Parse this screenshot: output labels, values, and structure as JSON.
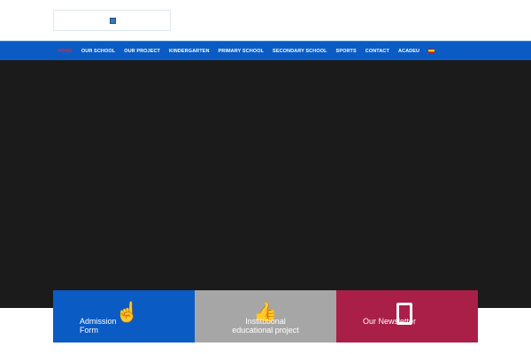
{
  "nav": {
    "items": [
      "HOME",
      "OUR SCHOOL",
      "OUR PROJECT",
      "KINDERGARTEN",
      "PRIMARY SCHOOL",
      "SECONDARY SCHOOL",
      "SPORTS",
      "CONTACT",
      "ACADEU"
    ]
  },
  "cards": [
    {
      "label": "Admission Form",
      "icon": "pointing-hand-icon"
    },
    {
      "label": "Institutional educational project",
      "icon": "thumbs-up-icon"
    },
    {
      "label": "Our Newsletter",
      "icon": "document-icon"
    }
  ],
  "colors": {
    "nav": "#0a5bc4",
    "card1": "#0a5bc4",
    "card2": "#a6a6a6",
    "card3": "#aa1f48",
    "active": "#c8323c"
  }
}
